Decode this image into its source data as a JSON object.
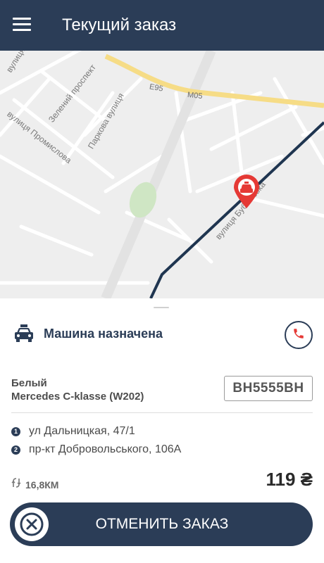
{
  "appbar": {
    "title": "Текущий заказ",
    "menu_icon": "hamburger-menu-icon"
  },
  "map": {
    "streets": [
      "вулиця П",
      "Зелений проспект",
      "вулиця Промислова",
      "Паркова вулиця",
      "вулиця Бубнівська"
    ],
    "road_codes": [
      "E95",
      "M05"
    ],
    "marker_icon": "taxi-marker-icon"
  },
  "ride": {
    "status": "Машина назначена",
    "status_icon": "car-icon",
    "call_icon": "phone-icon",
    "car_color": "Белый",
    "car_model": "Mercedes C-klasse (W202)",
    "plate": "BH5555BH"
  },
  "route": {
    "points": [
      {
        "num": "1",
        "address": "ул Дальницкая, 47/1"
      },
      {
        "num": "2",
        "address": "пр-кт Добровольського, 106А"
      }
    ],
    "distance": "16,8КМ",
    "distance_icon": "route-icon",
    "price": "119 ₴"
  },
  "actions": {
    "cancel_label": "ОТМЕНИТЬ ЗАКАЗ",
    "cancel_icon": "close-icon"
  },
  "colors": {
    "primary": "#2b3d57",
    "marker": "#e53935",
    "phone": "#e53935"
  }
}
